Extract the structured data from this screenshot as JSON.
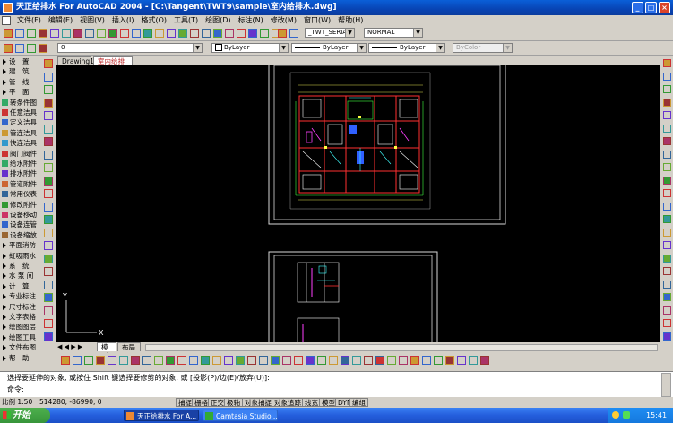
{
  "window": {
    "title": "天正给排水 For AutoCAD 2004 - [C:\\Tangent\\TWT9\\sample\\室内给排水.dwg]"
  },
  "menu": [
    "文件(F)",
    "编辑(E)",
    "视图(V)",
    "插入(I)",
    "格式(O)",
    "工具(T)",
    "绘图(D)",
    "标注(N)",
    "修改(M)",
    "窗口(W)",
    "帮助(H)"
  ],
  "toolbar": {
    "text_style": "_TWT_SERIAL",
    "dim_style": "NORMAL",
    "layer": "0",
    "color": "ByLayer",
    "linetype": "ByLayer",
    "lineweight": "ByLayer",
    "plot_style": "ByColor"
  },
  "doc_tabs": [
    "Drawing1",
    "室内给排水"
  ],
  "layout_tabs": [
    "模型",
    "布局1"
  ],
  "left_panel": [
    {
      "type": "head",
      "label": "设　置"
    },
    {
      "type": "head",
      "label": "建　筑"
    },
    {
      "type": "head",
      "label": "管　线"
    },
    {
      "type": "head",
      "label": "平　面"
    },
    {
      "type": "item",
      "label": "转条件图",
      "color": "#3a6"
    },
    {
      "type": "item",
      "label": "任意洁具",
      "color": "#c33"
    },
    {
      "type": "item",
      "label": "定义洁具",
      "color": "#36c"
    },
    {
      "type": "item",
      "label": "管连洁具",
      "color": "#c93"
    },
    {
      "type": "item",
      "label": "快连洁具",
      "color": "#39c"
    },
    {
      "type": "item",
      "label": "阀门阀件",
      "color": "#c33"
    },
    {
      "type": "item",
      "label": "给水附件",
      "color": "#3a6"
    },
    {
      "type": "item",
      "label": "排水附件",
      "color": "#63c"
    },
    {
      "type": "item",
      "label": "管道附件",
      "color": "#c63"
    },
    {
      "type": "item",
      "label": "常用仪表",
      "color": "#369"
    },
    {
      "type": "item",
      "label": "修改附件",
      "color": "#393"
    },
    {
      "type": "item",
      "label": "设备移动",
      "color": "#c36"
    },
    {
      "type": "item",
      "label": "设备连管",
      "color": "#36c"
    },
    {
      "type": "item",
      "label": "设备缩放",
      "color": "#963"
    },
    {
      "type": "head",
      "label": "平面消防"
    },
    {
      "type": "head",
      "label": "虹吸雨水"
    },
    {
      "type": "head",
      "label": "系　统"
    },
    {
      "type": "head",
      "label": "水 泵 间"
    },
    {
      "type": "head",
      "label": "计　算"
    },
    {
      "type": "head",
      "label": "专业标注"
    },
    {
      "type": "head",
      "label": "尺寸标注"
    },
    {
      "type": "head",
      "label": "文字表格"
    },
    {
      "type": "head",
      "label": "绘图图层"
    },
    {
      "type": "head",
      "label": "绘图工具"
    },
    {
      "type": "head",
      "label": "文件布图"
    },
    {
      "type": "head",
      "label": "帮　助"
    }
  ],
  "command": {
    "line1": "选择要延伸的对象, 或按住 Shift 键选择要修剪的对象, 或 [投影(P)/边(E)/放弃(U)]:",
    "line2": "命令:"
  },
  "status": {
    "scale": "比例 1:50",
    "coords": "514280, -86990, 0",
    "buttons": [
      "捕捉",
      "栅格",
      "正交",
      "极轴",
      "对象捕捉",
      "对象追踪",
      "线宽",
      "模型",
      "DYN",
      "编组"
    ]
  },
  "taskbar": {
    "start": "开始",
    "tasks": [
      "天正给排水 For A...",
      "Camtasia Studio ..."
    ],
    "clock": "15:41"
  },
  "colors": {
    "title_blue": "#0a5fd8",
    "canvas": "#000000",
    "taskbar": "#245edc",
    "start_green": "#37953a"
  },
  "icons": {
    "ucs": "ucs-axis-icon",
    "start": "windows-flag-icon"
  },
  "ucs": {
    "x": "X",
    "y": "Y"
  }
}
